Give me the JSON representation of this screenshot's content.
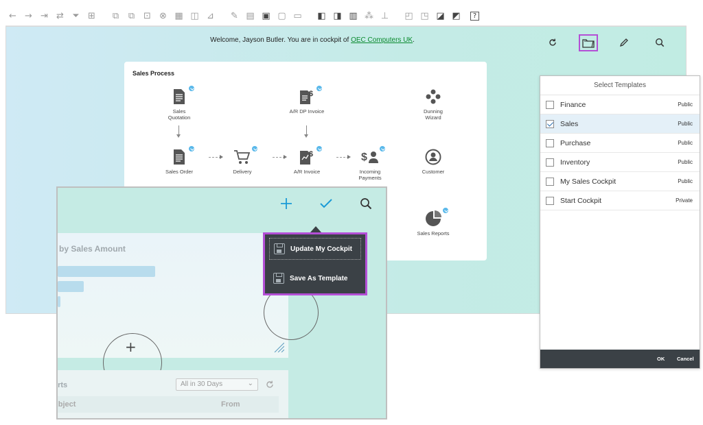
{
  "toolbar": {
    "icons": [
      "back-arrow",
      "forward-arrow",
      "last-arrow",
      "refresh-arrows",
      "filter-funnel",
      "find",
      "copy-doc",
      "paste-doc",
      "link",
      "layout",
      "table",
      "form",
      "edit",
      "doc-list",
      "comment",
      "message",
      "report",
      "report-settings",
      "calculator",
      "tree",
      "user",
      "print",
      "print-preview",
      "export",
      "chart",
      "settings-doc",
      "help"
    ],
    "help_label": "?"
  },
  "cockpit": {
    "welcome_prefix": "Welcome, Jayson Butler. You are in cockpit of ",
    "company_link": "OEC Computers UK",
    "welcome_suffix": "."
  },
  "sales_process": {
    "title": "Sales Process",
    "nodes": {
      "sales_quotation": "Sales\nQuotation",
      "ar_dp_invoice": "A/R DP Invoice",
      "dunning_wizard": "Dunning\nWizard",
      "sales_order": "Sales Order",
      "delivery": "Delivery",
      "ar_invoice": "A/R Invoice",
      "incoming_payments": "Incoming\nPayments",
      "customer": "Customer",
      "sales_reports": "Sales Reports"
    }
  },
  "zoom_panel": {
    "widget_title": "by Sales Amount",
    "alerts_title": "erts",
    "alerts_filter": "All in 30 Days",
    "col_subject": "ubject",
    "col_from": "From"
  },
  "dropdown": {
    "update_label": "Update My Cockpit",
    "save_label": "Save As Template"
  },
  "templates_dialog": {
    "title": "Select Templates",
    "rows": [
      {
        "name": "Finance",
        "visibility": "Public",
        "checked": false
      },
      {
        "name": "Sales",
        "visibility": "Public",
        "checked": true
      },
      {
        "name": "Purchase",
        "visibility": "Public",
        "checked": false
      },
      {
        "name": "Inventory",
        "visibility": "Public",
        "checked": false
      },
      {
        "name": "My Sales Cockpit",
        "visibility": "Public",
        "checked": false
      },
      {
        "name": "Start Cockpit",
        "visibility": "Private",
        "checked": false
      }
    ],
    "ok_label": "OK",
    "cancel_label": "Cancel"
  },
  "colors": {
    "accent_highlight": "#b44fd6",
    "badge_blue": "#59b8ea",
    "dark_bar": "#3b4146",
    "link_green": "#0a8a2e",
    "action_blue": "#1a9ad6"
  }
}
